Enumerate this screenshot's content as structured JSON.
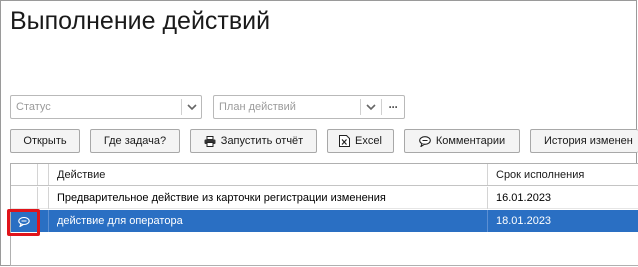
{
  "page": {
    "title": "Выполнение действий"
  },
  "filters": {
    "status_placeholder": "Статус",
    "plan_placeholder": "План действий",
    "more_glyph": "···"
  },
  "toolbar": {
    "open_label": "Открыть",
    "where_task_label": "Где задача?",
    "run_report_label": "Запустить отчёт",
    "excel_label": "Excel",
    "comments_label": "Комментарии",
    "history_label": "История изменен"
  },
  "table": {
    "columns": [
      "",
      "",
      "Действие",
      "Срок исполнения"
    ],
    "rows": [
      {
        "action": "Предварительное действие из карточки регистрации изменения",
        "due": "16.01.2023",
        "has_comment": false,
        "selected": false
      },
      {
        "action": "действие для оператора",
        "due": "18.01.2023",
        "has_comment": true,
        "selected": true
      }
    ]
  },
  "colors": {
    "selection": "#2a6fc3",
    "highlight_border": "#e0141a"
  },
  "icons": {
    "chevron": "chevron-down-icon",
    "more": "more-icon",
    "print": "print-icon",
    "excel": "excel-icon",
    "comment": "comment-icon"
  }
}
